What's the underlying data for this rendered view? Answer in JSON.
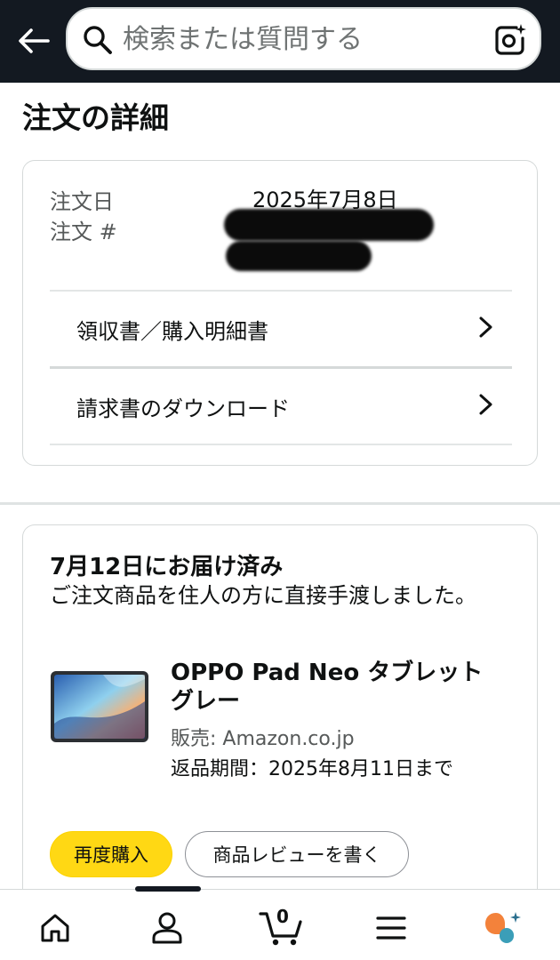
{
  "header": {
    "search_placeholder": "検索または質問する",
    "icons": {
      "back": "arrow-left-icon",
      "search": "search-icon",
      "camera": "camera-lens-icon"
    }
  },
  "page": {
    "title": "注文の詳細"
  },
  "order_summary": {
    "date_label": "注文日",
    "date_value": "2025年7月8日",
    "number_label": "注文 #",
    "number_value_redacted": true,
    "links": [
      {
        "label": "領収書／購入明細書"
      },
      {
        "label": "請求書のダウンロード"
      }
    ]
  },
  "delivery": {
    "status": "7月12日にお届け済み",
    "note": "ご注文商品を住人の方に直接手渡しました。",
    "product": {
      "title_line1": "OPPO Pad Neo タブレット",
      "title_line2": "グレー",
      "seller": "販売: Amazon.co.jp",
      "return_window": "返品期間：2025年8月11日まで"
    },
    "buttons": {
      "buy_again": "再度購入",
      "write_review": "商品レビューを書く"
    }
  },
  "bottom_nav": {
    "cart_count": "0",
    "items": [
      "home-icon",
      "account-icon",
      "cart-icon",
      "menu-icon",
      "rufus-assistant-icon"
    ]
  },
  "colors": {
    "header_bg": "#131921",
    "buy_again_bg": "#ffd814",
    "rufus_orange": "#f3823b",
    "rufus_teal": "#3b9eb8"
  }
}
